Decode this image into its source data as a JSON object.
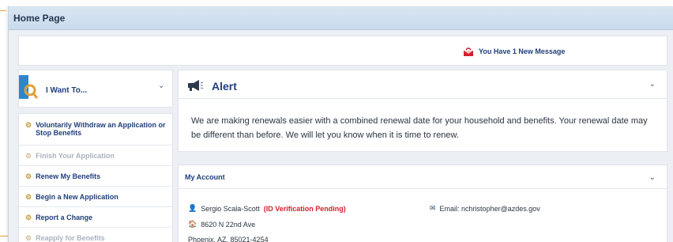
{
  "topbar": {
    "title": "Home Page"
  },
  "messages": {
    "text": "You Have 1 New Message"
  },
  "iwant": {
    "label": "I Want To..."
  },
  "menu": [
    {
      "label": "Voluntarily Withdraw an Application or Stop Benefits",
      "enabled": true
    },
    {
      "label": "Finish Your Application",
      "enabled": false
    },
    {
      "label": "Renew My Benefits",
      "enabled": true
    },
    {
      "label": "Begin a New Application",
      "enabled": true
    },
    {
      "label": "Report a Change",
      "enabled": true
    },
    {
      "label": "Reapply for Benefits",
      "enabled": false
    }
  ],
  "alert": {
    "title": "Alert",
    "body": "We are making renewals easier with a combined renewal date for your household and benefits. Your renewal date may be different than before. We will let you know when it is time to renew."
  },
  "account": {
    "title": "My Account",
    "name": "Sergio Scala-Scott",
    "status": "(ID Verification Pending)",
    "email": "Email: nchristopher@azdes.gov",
    "address1": "8620 N 22nd Ave",
    "address2": "Phoenix, AZ, 85021-4254"
  },
  "colors": {
    "accent": "#203f7a",
    "warning": "#d3202a",
    "topbar": "#d9e6f3"
  }
}
